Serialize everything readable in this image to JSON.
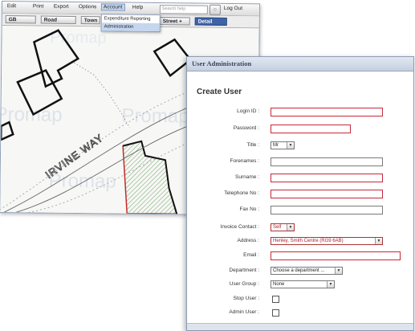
{
  "menubar": {
    "items": [
      "Edit",
      "Print",
      "Export",
      "Options",
      "Account",
      "Help"
    ],
    "search_placeholder": "Search help",
    "logout_label": "Log Out"
  },
  "toolbar": {
    "buttons": [
      "GB",
      "Road",
      "Town",
      "Street +",
      "Detail"
    ]
  },
  "account_menu": {
    "items": [
      "Expenditure Reporting",
      "Administration"
    ]
  },
  "map": {
    "road_label": "IRVINE WAY",
    "watermark": "Promap"
  },
  "admin": {
    "window_title": "User Administration",
    "heading": "Create User",
    "fields": {
      "login_id": {
        "label": "Login ID :"
      },
      "password": {
        "label": "Password :"
      },
      "title": {
        "label": "Title :",
        "value": "Mr"
      },
      "forenames": {
        "label": "Forenames :"
      },
      "surname": {
        "label": "Surname :"
      },
      "telephone": {
        "label": "Telephone No :"
      },
      "fax": {
        "label": "Fax No :"
      },
      "invoice_contact": {
        "label": "Invoice Contact :",
        "value": "Self"
      },
      "address": {
        "label": "Address :",
        "value": "Henley, Smith Centre (RG9 6AB)"
      },
      "email": {
        "label": "Email :"
      },
      "department": {
        "label": "Department :",
        "value": "Choose a department ..."
      },
      "user_group": {
        "label": "User Group :",
        "value": "None"
      },
      "stop_user": {
        "label": "Stop User :"
      },
      "admin_user": {
        "label": "Admin User :"
      }
    }
  }
}
